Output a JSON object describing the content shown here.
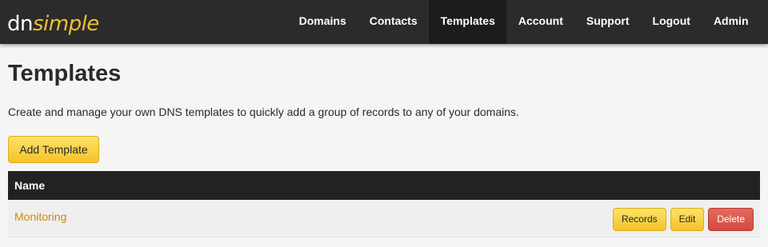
{
  "logo": {
    "part1": "dn",
    "part2": "simple"
  },
  "nav": {
    "items": [
      {
        "label": "Domains"
      },
      {
        "label": "Contacts"
      },
      {
        "label": "Templates"
      },
      {
        "label": "Account"
      },
      {
        "label": "Support"
      },
      {
        "label": "Logout"
      },
      {
        "label": "Admin"
      }
    ],
    "active": "Templates"
  },
  "page": {
    "title": "Templates",
    "description": "Create and manage your own DNS templates to quickly add a group of records to any of your domains.",
    "add_button": "Add Template"
  },
  "table": {
    "header": "Name",
    "rows": [
      {
        "name": "Monitoring",
        "actions": {
          "records": "Records",
          "edit": "Edit",
          "delete": "Delete"
        }
      }
    ]
  },
  "colors": {
    "navbar": "#2b2b2b",
    "brand_yellow": "#f2c12e",
    "link": "#c98a14",
    "delete": "#d44a3e",
    "table_header": "#222222"
  }
}
